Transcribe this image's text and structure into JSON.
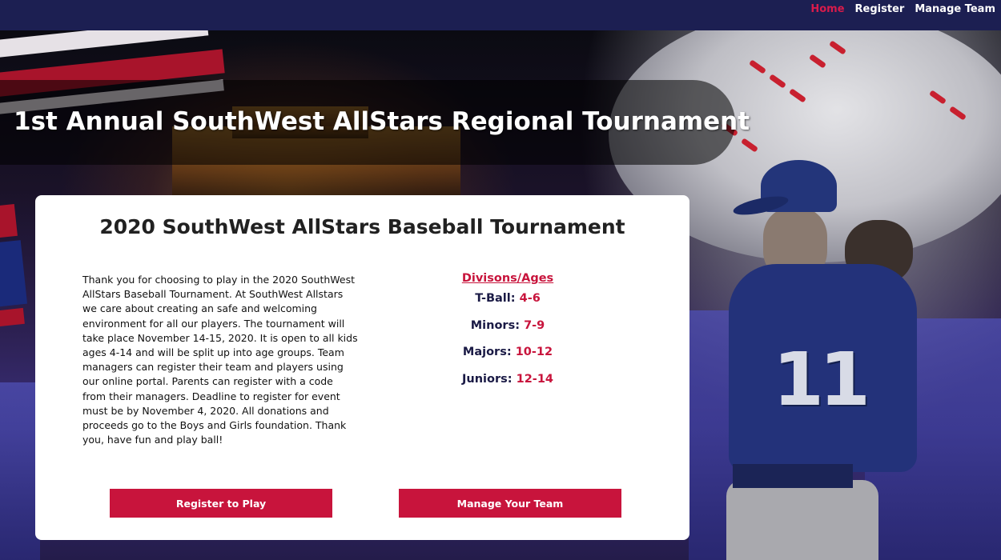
{
  "nav": {
    "items": [
      {
        "label": "Home",
        "active": true
      },
      {
        "label": "Register",
        "active": false
      },
      {
        "label": "Manage Team",
        "active": false
      }
    ]
  },
  "hero": {
    "title": "1st Annual SouthWest AllStars Regional Tournament",
    "jersey_number": "11"
  },
  "card": {
    "title": "2020 SouthWest AllStars Baseball Tournament",
    "intro": "Thank you for choosing to play in the 2020 SouthWest AllStars Baseball Tournament. At SouthWest Allstars we care about creating an safe and welcoming environment for all our players. The tournament will take place November 14-15, 2020. It is open to all kids ages 4-14 and will be split up into age groups. Team managers can register their team and players using our online portal. Parents can register with a code from their managers. Deadline to register for event must be by November 4, 2020. All donations and proceeds go to the Boys and Girls foundation. Thank you, have fun and play ball!",
    "divisions": {
      "header": "Divisons/Ages",
      "items": [
        {
          "name": "T-Ball:",
          "ages": "4-6"
        },
        {
          "name": "Minors:",
          "ages": "7-9"
        },
        {
          "name": "Majors:",
          "ages": "10-12"
        },
        {
          "name": "Juniors:",
          "ages": "12-14"
        }
      ]
    },
    "buttons": {
      "register": "Register to Play",
      "manage": "Manage Your Team"
    }
  },
  "colors": {
    "navbar": "#1c1f52",
    "accent": "#c8143c",
    "nav_active": "#d81b4b",
    "division_name": "#1a1a45"
  }
}
